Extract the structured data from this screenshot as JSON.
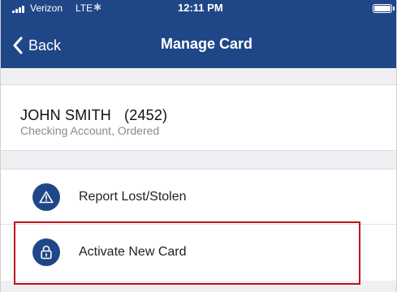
{
  "status_bar": {
    "carrier": "Verizon",
    "network": "LTE",
    "activity_icon": "activity-spinner-icon",
    "time": "12:11 PM",
    "battery_level": 1.0
  },
  "nav": {
    "back_label": "Back",
    "title": "Manage Card"
  },
  "card": {
    "holder_name": "JOHN SMITH",
    "card_suffix": "(2452)",
    "subtitle": "Checking Account, Ordered"
  },
  "actions": [
    {
      "label": "Report Lost/Stolen",
      "icon": "warning-icon"
    },
    {
      "label": "Activate New Card",
      "icon": "lock-icon"
    }
  ],
  "colors": {
    "header_bg": "#1f4788",
    "icon_bg": "#1f4788",
    "highlight": "#c0141c",
    "page_bg": "#efeff4"
  }
}
